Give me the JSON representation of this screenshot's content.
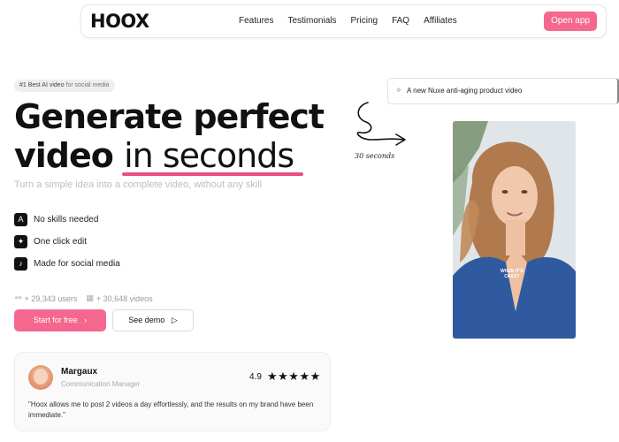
{
  "nav": {
    "logo": "HOOX",
    "links": [
      "Features",
      "Testimonials",
      "Pricing",
      "FAQ",
      "Affiliates"
    ],
    "cta": "Open app"
  },
  "hero": {
    "badge_strong": "#1 Best AI video",
    "badge_muted": "for social media",
    "title_line1": "Generate perfect",
    "title_line2_a": "video",
    "title_line2_b": "in seconds",
    "subtitle": "Turn a simple idea into a complete video, without any skill",
    "features": [
      {
        "icon": "A",
        "label": "No skills needed"
      },
      {
        "icon": "✦",
        "label": "One click edit"
      },
      {
        "icon": "♪",
        "label": "Made for social media"
      }
    ],
    "stats": {
      "users": "+ 29,343 users",
      "videos": "+ 30,648 videos"
    },
    "primary_cta": "Start for free",
    "primary_cta_icon": "›",
    "secondary_cta": "See demo",
    "secondary_cta_icon": "▷"
  },
  "testimonial": {
    "name": "Margaux",
    "role": "Communication Manager",
    "rating": "4.9",
    "stars": "★★★★★",
    "quote": "\"Hoox allows me to post 2 videos a day effortlessly, and the results on my brand have been immediate.\""
  },
  "demo": {
    "prompt_icon": "✧",
    "prompt": "A new Nuxe anti-aging product video",
    "arrow_label": "30 seconds",
    "caption_line1": "WHEN IT'S",
    "caption_line2": "CRAZY"
  }
}
